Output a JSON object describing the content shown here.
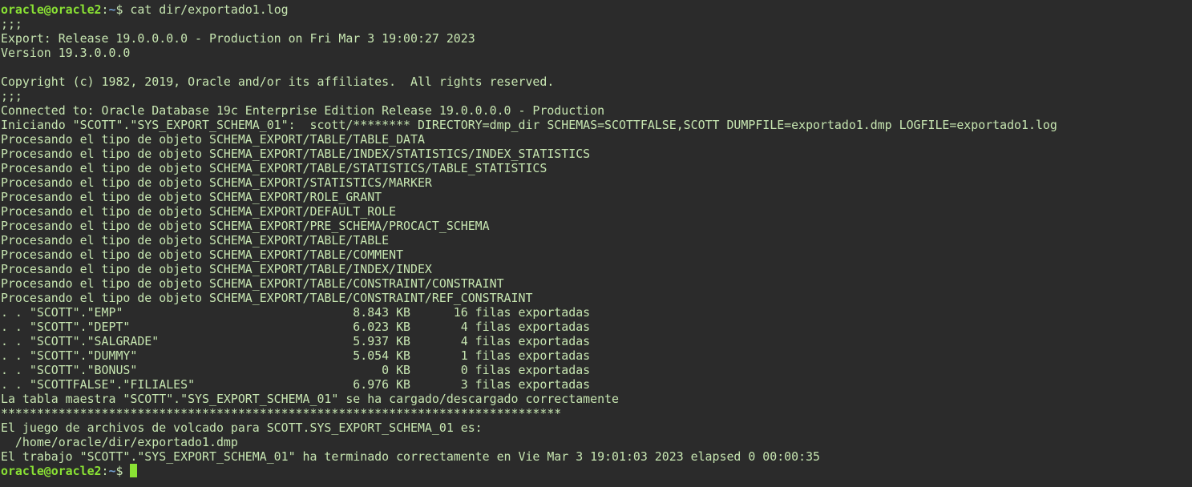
{
  "prompt": {
    "user_host": "oracle@oracle2",
    "separator": ":",
    "path": "~",
    "symbol": "$ "
  },
  "command": "cat dir/exportado1.log",
  "output_lines": [
    ";;;",
    "Export: Release 19.0.0.0.0 - Production on Fri Mar 3 19:00:27 2023",
    "Version 19.3.0.0.0",
    "",
    "Copyright (c) 1982, 2019, Oracle and/or its affiliates.  All rights reserved.",
    ";;;",
    "Connected to: Oracle Database 19c Enterprise Edition Release 19.0.0.0.0 - Production",
    "Iniciando \"SCOTT\".\"SYS_EXPORT_SCHEMA_01\":  scott/******** DIRECTORY=dmp_dir SCHEMAS=SCOTTFALSE,SCOTT DUMPFILE=exportado1.dmp LOGFILE=exportado1.log",
    "Procesando el tipo de objeto SCHEMA_EXPORT/TABLE/TABLE_DATA",
    "Procesando el tipo de objeto SCHEMA_EXPORT/TABLE/INDEX/STATISTICS/INDEX_STATISTICS",
    "Procesando el tipo de objeto SCHEMA_EXPORT/TABLE/STATISTICS/TABLE_STATISTICS",
    "Procesando el tipo de objeto SCHEMA_EXPORT/STATISTICS/MARKER",
    "Procesando el tipo de objeto SCHEMA_EXPORT/ROLE_GRANT",
    "Procesando el tipo de objeto SCHEMA_EXPORT/DEFAULT_ROLE",
    "Procesando el tipo de objeto SCHEMA_EXPORT/PRE_SCHEMA/PROCACT_SCHEMA",
    "Procesando el tipo de objeto SCHEMA_EXPORT/TABLE/TABLE",
    "Procesando el tipo de objeto SCHEMA_EXPORT/TABLE/COMMENT",
    "Procesando el tipo de objeto SCHEMA_EXPORT/TABLE/INDEX/INDEX",
    "Procesando el tipo de objeto SCHEMA_EXPORT/TABLE/CONSTRAINT/CONSTRAINT",
    "Procesando el tipo de objeto SCHEMA_EXPORT/TABLE/CONSTRAINT/REF_CONSTRAINT",
    ". . \"SCOTT\".\"EMP\"                                8.843 KB      16 filas exportadas",
    ". . \"SCOTT\".\"DEPT\"                               6.023 KB       4 filas exportadas",
    ". . \"SCOTT\".\"SALGRADE\"                           5.937 KB       4 filas exportadas",
    ". . \"SCOTT\".\"DUMMY\"                              5.054 KB       1 filas exportadas",
    ". . \"SCOTT\".\"BONUS\"                                  0 KB       0 filas exportadas",
    ". . \"SCOTTFALSE\".\"FILIALES\"                      6.976 KB       3 filas exportadas",
    "La tabla maestra \"SCOTT\".\"SYS_EXPORT_SCHEMA_01\" se ha cargado/descargado correctamente",
    "******************************************************************************",
    "El juego de archivos de volcado para SCOTT.SYS_EXPORT_SCHEMA_01 es:",
    "  /home/oracle/dir/exportado1.dmp",
    "El trabajo \"SCOTT\".\"SYS_EXPORT_SCHEMA_01\" ha terminado correctamente en Vie Mar 3 19:01:03 2023 elapsed 0 00:00:35"
  ],
  "colors": {
    "background": "#2b2b2b",
    "text": "#c7e6b1",
    "user_host": "#8ae234",
    "path": "#729fcf",
    "cursor": "#8ae234"
  }
}
